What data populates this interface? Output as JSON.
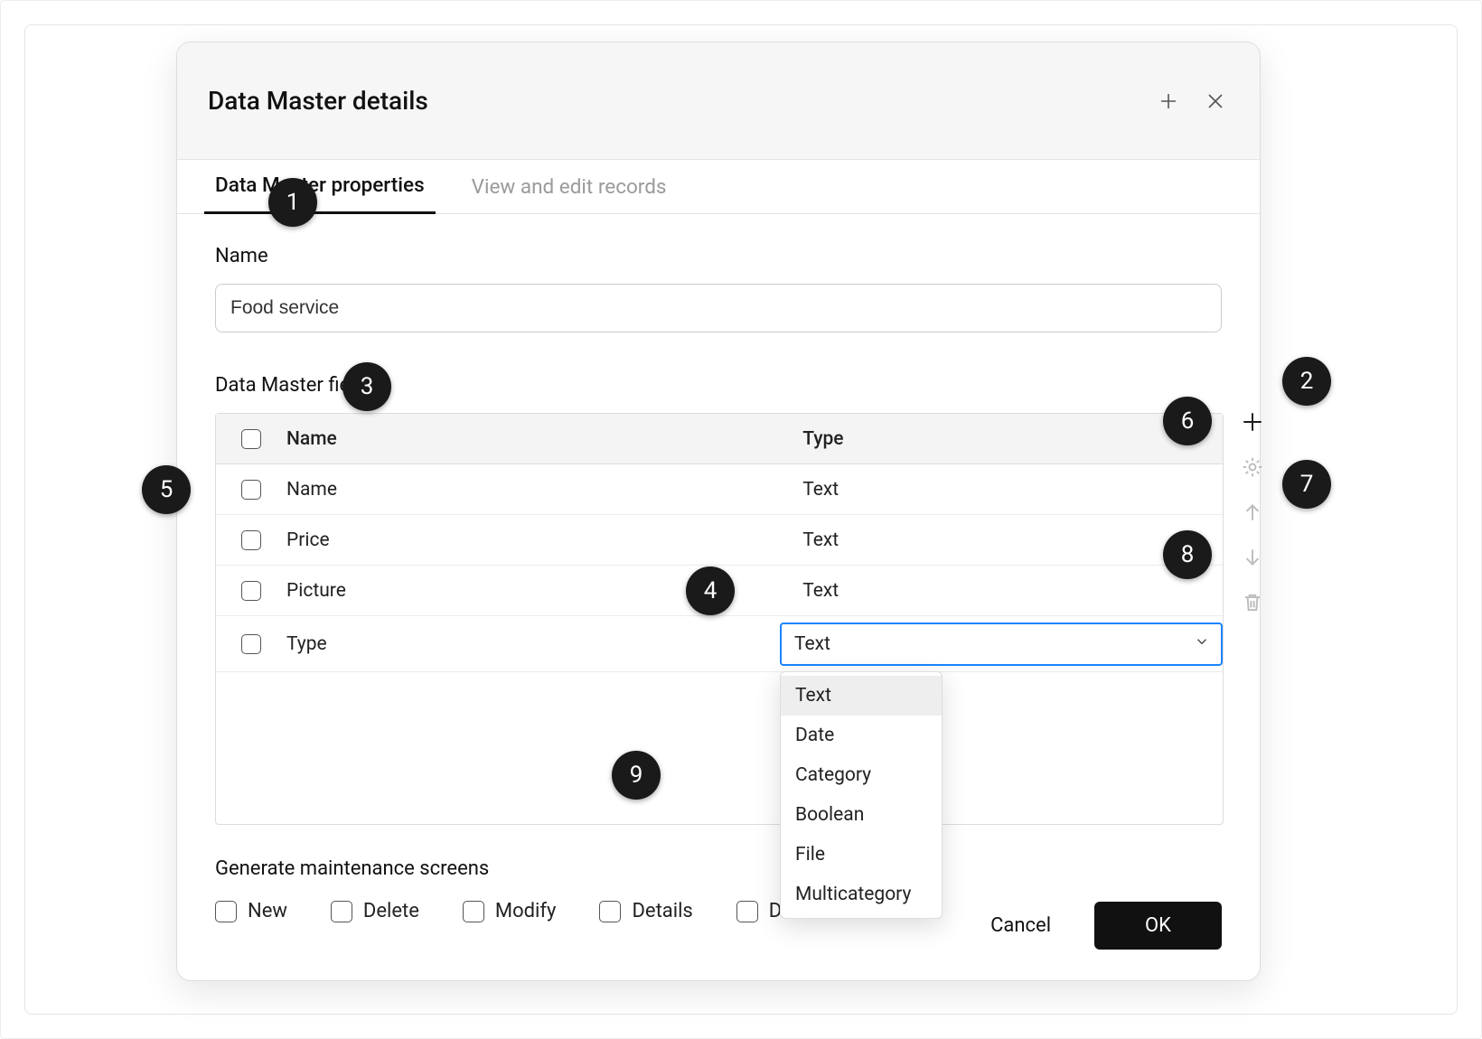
{
  "dialog": {
    "title": "Data Master details"
  },
  "tabs": [
    {
      "label": "Data Master properties",
      "active": true
    },
    {
      "label": "View and edit records",
      "active": false
    }
  ],
  "name_section": {
    "label": "Name",
    "value": "Food service"
  },
  "fields_section": {
    "label": "Data Master fields",
    "columns": {
      "name": "Name",
      "type": "Type"
    },
    "rows": [
      {
        "name": "Name",
        "type": "Text"
      },
      {
        "name": "Price",
        "type": "Text"
      },
      {
        "name": "Picture",
        "type": "Text"
      },
      {
        "name": "Type",
        "type": "Text",
        "editing": true
      }
    ],
    "type_dropdown": {
      "selected": "Text",
      "options": [
        "Text",
        "Date",
        "Category",
        "Boolean",
        "File",
        "Multicategory"
      ]
    }
  },
  "maintenance": {
    "label": "Generate maintenance screens",
    "options": [
      "New",
      "Delete",
      "Modify",
      "Details",
      "D"
    ]
  },
  "footer": {
    "cancel": "Cancel",
    "ok": "OK"
  },
  "markers": [
    "1",
    "2",
    "3",
    "4",
    "5",
    "6",
    "7",
    "8",
    "9"
  ]
}
